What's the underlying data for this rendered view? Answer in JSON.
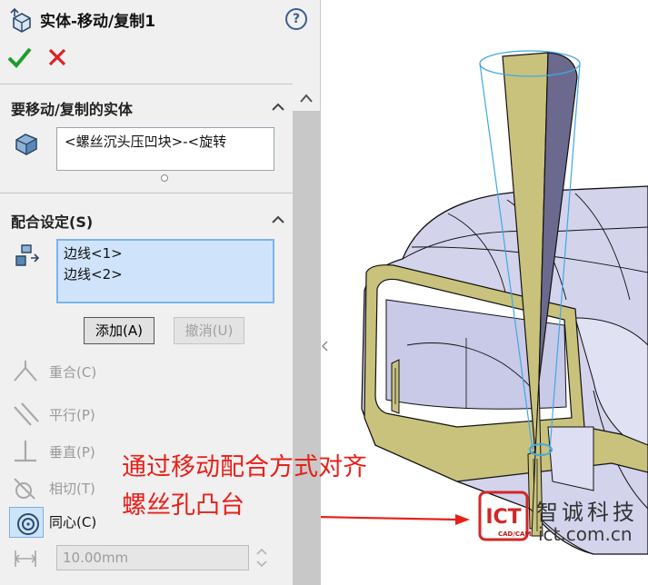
{
  "panel": {
    "title": "实体-移动/复制1",
    "help_icon": "?",
    "ok_icon": "check-icon",
    "cancel_icon": "close-icon"
  },
  "bodies_section": {
    "header": "要移动/复制的实体",
    "items": [
      "<螺丝沉头压凹块>-<旋转"
    ]
  },
  "mate_section": {
    "header": "配合设定(S)",
    "selections": [
      "边线<1>",
      "边线<2>"
    ],
    "add_label": "添加(A)",
    "undo_label": "撤消(U)",
    "mate_types": [
      {
        "label": "重合(C)",
        "icon": "coincident-icon",
        "enabled": false
      },
      {
        "label": "平行(P)",
        "icon": "parallel-icon",
        "enabled": false
      },
      {
        "label": "垂直(P)",
        "icon": "perpendicular-icon",
        "enabled": false
      },
      {
        "label": "相切(T)",
        "icon": "tangent-icon",
        "enabled": false
      },
      {
        "label": "同心(C)",
        "icon": "concentric-icon",
        "enabled": true,
        "selected": true
      }
    ],
    "distance_value": "10.00mm"
  },
  "annotation": {
    "lines": [
      "通过移动配合方式对齐",
      "螺丝孔凸台"
    ],
    "color": "#e8201a"
  },
  "watermark": {
    "logo_letters": "ICT",
    "logo_sub": "CAD/CAM",
    "name": "智诚科技",
    "url": "ict.com.cn"
  },
  "colors": {
    "part_face": "#c9c9e8",
    "section_face": "#c8c07a",
    "selection_blue": "#cfe4fb"
  }
}
